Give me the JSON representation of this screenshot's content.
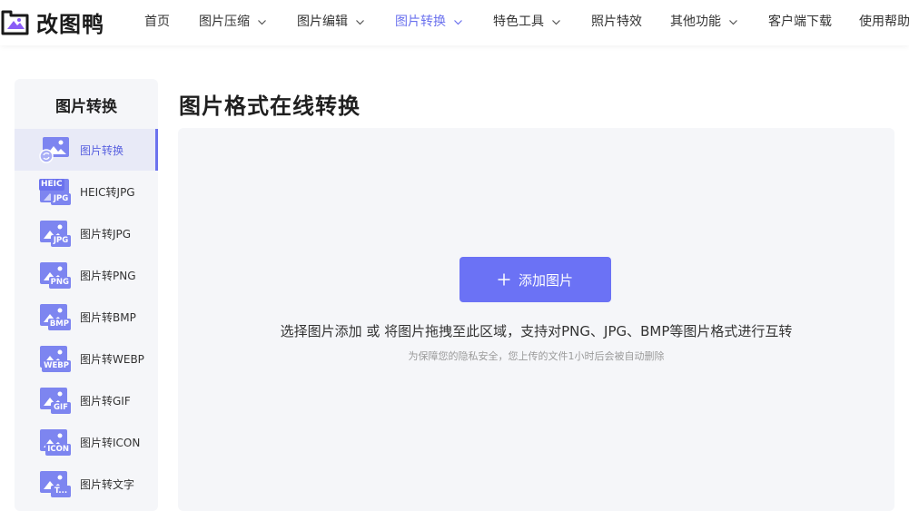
{
  "brand": {
    "name": "改图鸭"
  },
  "nav": {
    "items": [
      {
        "label": "首页",
        "has_dropdown": false,
        "active": false
      },
      {
        "label": "图片压缩",
        "has_dropdown": true,
        "active": false
      },
      {
        "label": "图片编辑",
        "has_dropdown": true,
        "active": false
      },
      {
        "label": "图片转换",
        "has_dropdown": true,
        "active": true
      },
      {
        "label": "特色工具",
        "has_dropdown": true,
        "active": false
      },
      {
        "label": "照片特效",
        "has_dropdown": false,
        "active": false
      },
      {
        "label": "其他功能",
        "has_dropdown": true,
        "active": false
      },
      {
        "label": "客户端下载",
        "has_dropdown": false,
        "active": false
      },
      {
        "label": "使用帮助",
        "has_dropdown": false,
        "active": false
      }
    ]
  },
  "sidebar": {
    "title": "图片转换",
    "items": [
      {
        "label": "图片转换",
        "icon": "image-convert-icon",
        "badge": "",
        "active": true
      },
      {
        "label": "HEIC转JPG",
        "icon": "heic-to-jpg-icon",
        "badge": "JPG",
        "top_badge": "HEIC",
        "active": false
      },
      {
        "label": "图片转JPG",
        "icon": "jpg-icon",
        "badge": "JPG",
        "active": false
      },
      {
        "label": "图片转PNG",
        "icon": "png-icon",
        "badge": "PNG",
        "active": false
      },
      {
        "label": "图片转BMP",
        "icon": "bmp-icon",
        "badge": "BMP",
        "active": false
      },
      {
        "label": "图片转WEBP",
        "icon": "webp-icon",
        "badge": "WEBP",
        "active": false
      },
      {
        "label": "图片转GIF",
        "icon": "gif-icon",
        "badge": "GIF",
        "active": false
      },
      {
        "label": "图片转ICON",
        "icon": "icon-format-icon",
        "badge": "ICON",
        "active": false
      },
      {
        "label": "图片转文字",
        "icon": "text-format-icon",
        "badge": "T...",
        "active": false
      }
    ]
  },
  "main": {
    "title": "图片格式在线转换",
    "add_button_label": "添加图片",
    "upload_hint": "选择图片添加 或 将图片拖拽至此区域，支持对PNG、JPG、BMP等图片格式进行互转",
    "privacy_note": "为保障您的隐私安全，您上传的文件1小时后会被自动删除"
  },
  "colors": {
    "accent": "#6b72f5",
    "active_nav": "#6b72ee",
    "panel_bg": "#f5f6f9"
  }
}
